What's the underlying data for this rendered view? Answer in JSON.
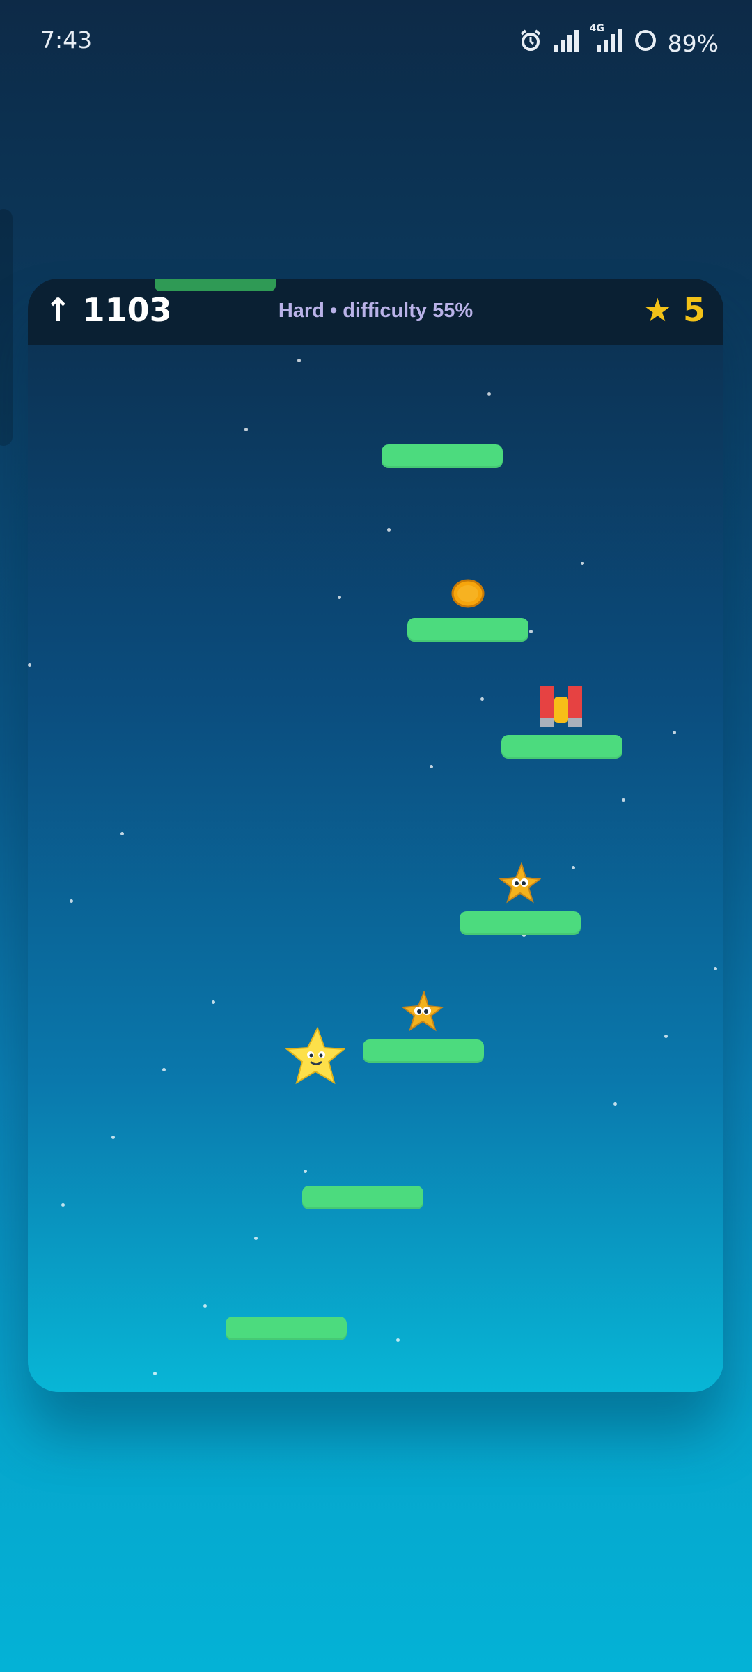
{
  "status_bar": {
    "time": "7:43",
    "battery": "89%",
    "network": "4G",
    "icons": [
      "alarm-icon",
      "signal-icon",
      "signal-4g-icon",
      "battery-ring-icon"
    ]
  },
  "hud": {
    "score": "1103",
    "score_arrow": "↑",
    "difficulty": "Hard • difficulty 55%",
    "star_icon": "★",
    "stars": "5"
  },
  "game": {
    "items": [
      "coin-icon",
      "magnet-icon",
      "star-enemy-small",
      "star-enemy-small",
      "star-player"
    ],
    "colors": {
      "platform": "#4cdb7e",
      "hud_bg": "#0a2033",
      "accent_star": "#f3c218",
      "difficulty_text": "#b9b2e8"
    }
  }
}
